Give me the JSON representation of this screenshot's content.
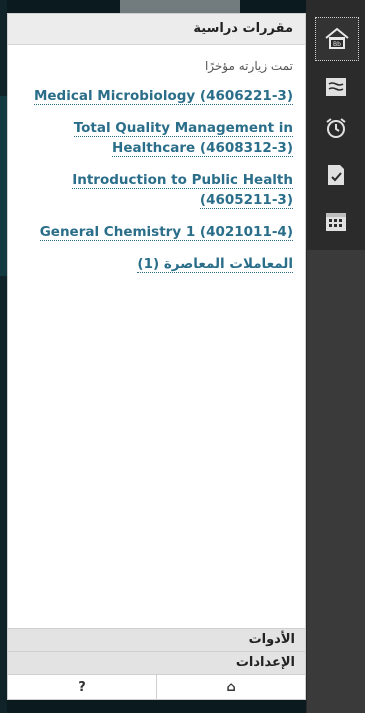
{
  "panel": {
    "title": "مقررات دراسية",
    "recent_label": "تمت زيارته مؤخرًا",
    "courses": [
      {
        "name": "Medical Microbiology (4606221-3)"
      },
      {
        "name": "Total Quality Management in Healthcare (4608312-3)"
      },
      {
        "name": "Introduction to Public Health (4605211-3)"
      },
      {
        "name": "General Chemistry 1 (4021011-4)"
      },
      {
        "name": "المعاملات المعاصرة (1)"
      }
    ],
    "tools_label": "الأدوات",
    "settings_label": "الإعدادات",
    "help_label": "?",
    "institution_label": "⌂"
  },
  "rail": {
    "items": [
      {
        "icon": "blackboard-home-icon"
      },
      {
        "icon": "stream-icon"
      },
      {
        "icon": "alarm-clock-icon"
      },
      {
        "icon": "grades-icon"
      },
      {
        "icon": "calendar-icon"
      }
    ]
  },
  "colors": {
    "link": "#2a6e8a",
    "rail_bg": "#3a3a3a",
    "panel_header_bg": "#ececec"
  }
}
